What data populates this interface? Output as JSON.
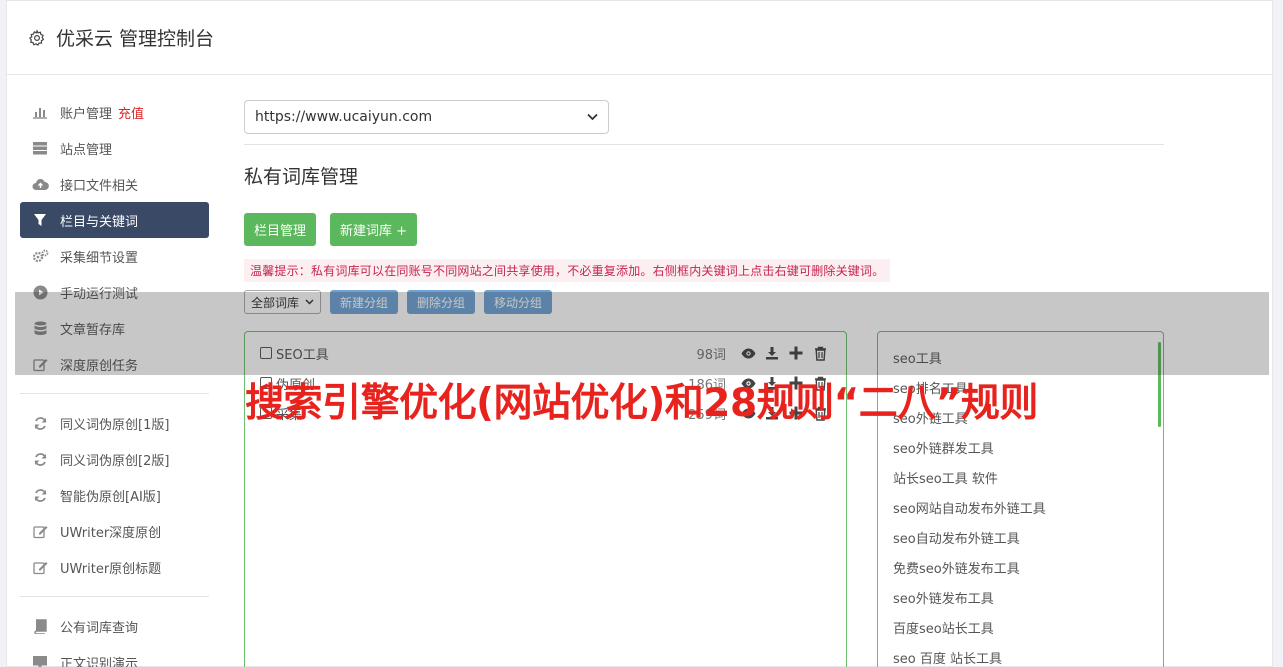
{
  "header": {
    "title": "优采云 管理控制台"
  },
  "sidebar": {
    "group1": [
      {
        "label": "账户管理",
        "badge": "充值",
        "icon": "bar-chart-icon"
      },
      {
        "label": "站点管理",
        "icon": "server-icon"
      },
      {
        "label": "接口文件相关",
        "icon": "cloud-upload-icon"
      },
      {
        "label": "栏目与关键词",
        "icon": "filter-icon",
        "active": true
      },
      {
        "label": "采集细节设置",
        "icon": "gears-icon"
      },
      {
        "label": "手动运行测试",
        "icon": "play-icon"
      },
      {
        "label": "文章暂存库",
        "icon": "database-icon"
      },
      {
        "label": "深度原创任务",
        "icon": "edit-icon"
      }
    ],
    "group2": [
      {
        "label": "同义词伪原创[1版]",
        "icon": "refresh-icon"
      },
      {
        "label": "同义词伪原创[2版]",
        "icon": "refresh-icon"
      },
      {
        "label": "智能伪原创[AI版]",
        "icon": "refresh-icon"
      },
      {
        "label": "UWriter深度原创",
        "icon": "edit-icon"
      },
      {
        "label": "UWriter原创标题",
        "icon": "edit-icon"
      }
    ],
    "group3": [
      {
        "label": "公有词库查询",
        "icon": "book-icon"
      },
      {
        "label": "正文识别演示",
        "icon": "monitor-icon"
      }
    ]
  },
  "main": {
    "site_select": "https://www.ucaiyun.com",
    "section_title": "私有词库管理",
    "btn_column": "栏目管理",
    "btn_new_lib": "新建词库 +",
    "tip": "温馨提示：私有词库可以在同账号不同网站之间共享使用，不必重复添加。右侧框内关键词上点击右键可删除关键词。",
    "filter_select": "全部词库",
    "btn_new_group": "新建分组",
    "btn_del_group": "删除分组",
    "btn_move_group": "移动分组"
  },
  "libraries": [
    {
      "name": "SEO工具",
      "count": "98词"
    },
    {
      "name": "伪原创",
      "count": "186词"
    },
    {
      "name": "采集",
      "count": "259词"
    }
  ],
  "keywords": [
    "seo工具",
    "seo排名工具",
    "seo外链工具",
    "seo外链群发工具",
    "站长seo工具 软件",
    "seo网站自动发布外链工具",
    "seo自动发布外链工具",
    "免费seo外链发布工具",
    "seo外链发布工具",
    "百度seo站长工具",
    "seo 百度 站长工具"
  ],
  "watermark": "搜索引擎优化(网站优化)和28规则“二八”规则",
  "colors": {
    "green": "#5cb85c",
    "nav_active": "#3a4a66",
    "tip_red": "#c7254e",
    "btn_blue": "#6fa3d6",
    "watermark_red": "#e8231e"
  }
}
